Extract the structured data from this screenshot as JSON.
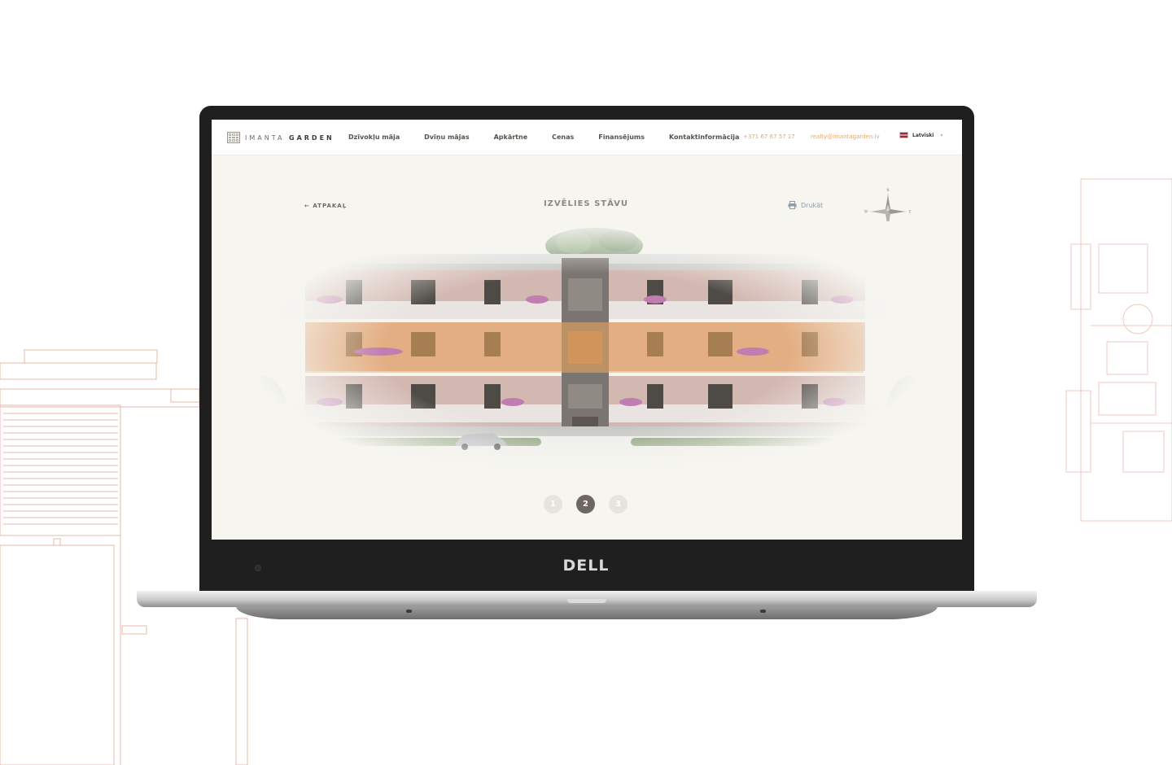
{
  "device": {
    "brand": "DELL"
  },
  "site": {
    "logo": {
      "light": "IMANTA",
      "bold": "GARDEN"
    },
    "nav": [
      {
        "label": "Dzīvokļu māja"
      },
      {
        "label": "Dvīņu mājas"
      },
      {
        "label": "Apkārtne"
      },
      {
        "label": "Cenas"
      },
      {
        "label": "Finansējums"
      },
      {
        "label": "Kontaktinformācija"
      }
    ],
    "contact": {
      "phone": "+371 67 67 57 17",
      "email": "realty@imantagarden.lv"
    },
    "language": {
      "selected": "Latviski"
    }
  },
  "floor_select": {
    "back_label": "ATPAKAĻ",
    "title": "IZVĒLIES STĀVU",
    "print_label": "Drukāt",
    "compass": {
      "n": "N",
      "e": "E",
      "s": "S",
      "w": "W"
    },
    "pages": [
      {
        "label": "1"
      },
      {
        "label": "2"
      },
      {
        "label": "3"
      }
    ],
    "active_page": "2"
  },
  "colors": {
    "accent": "#e8a766",
    "active_dot": "#6d6661",
    "floor_highlight": "#f0a75d"
  }
}
